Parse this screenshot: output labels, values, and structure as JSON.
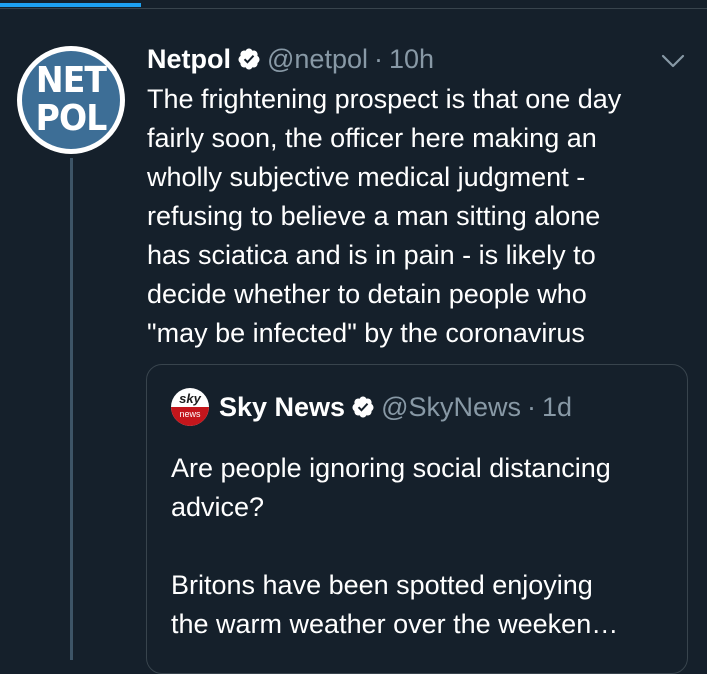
{
  "top_bar": {
    "progress_percent": 20,
    "accent_color": "#1da1f2"
  },
  "tweet": {
    "avatar": {
      "line1": "NET",
      "line2": "POL"
    },
    "author_name": "Netpol",
    "verified_icon": "verified-badge-icon",
    "handle": "@netpol",
    "separator": "·",
    "time": "10h",
    "menu_icon": "chevron-down-icon",
    "text": "The frightening prospect is that one day\nfairly soon, the officer here making an\nwholly subjective medical judgment -\nrefusing to believe a man sitting alone\nhas sciatica and is in pain - is likely to\ndecide whether to detain people who\n\"may be infected\" by the coronavirus"
  },
  "quoted_tweet": {
    "avatar": {
      "word1": "sky",
      "word2": "news"
    },
    "author_name": "Sky News",
    "verified_icon": "verified-badge-icon",
    "handle": "@SkyNews",
    "separator": "·",
    "time": "1d",
    "text": "Are people ignoring social distancing\nadvice?\n\nBritons have been spotted enjoying\nthe warm weather over the weeken…"
  },
  "colors": {
    "background": "#15202b",
    "text_primary": "#ffffff",
    "text_secondary": "#8899a6",
    "border": "#38444d",
    "thread_line": "#3d5466",
    "netpol_blue": "#3d6e96",
    "sky_red": "#c4161c"
  }
}
